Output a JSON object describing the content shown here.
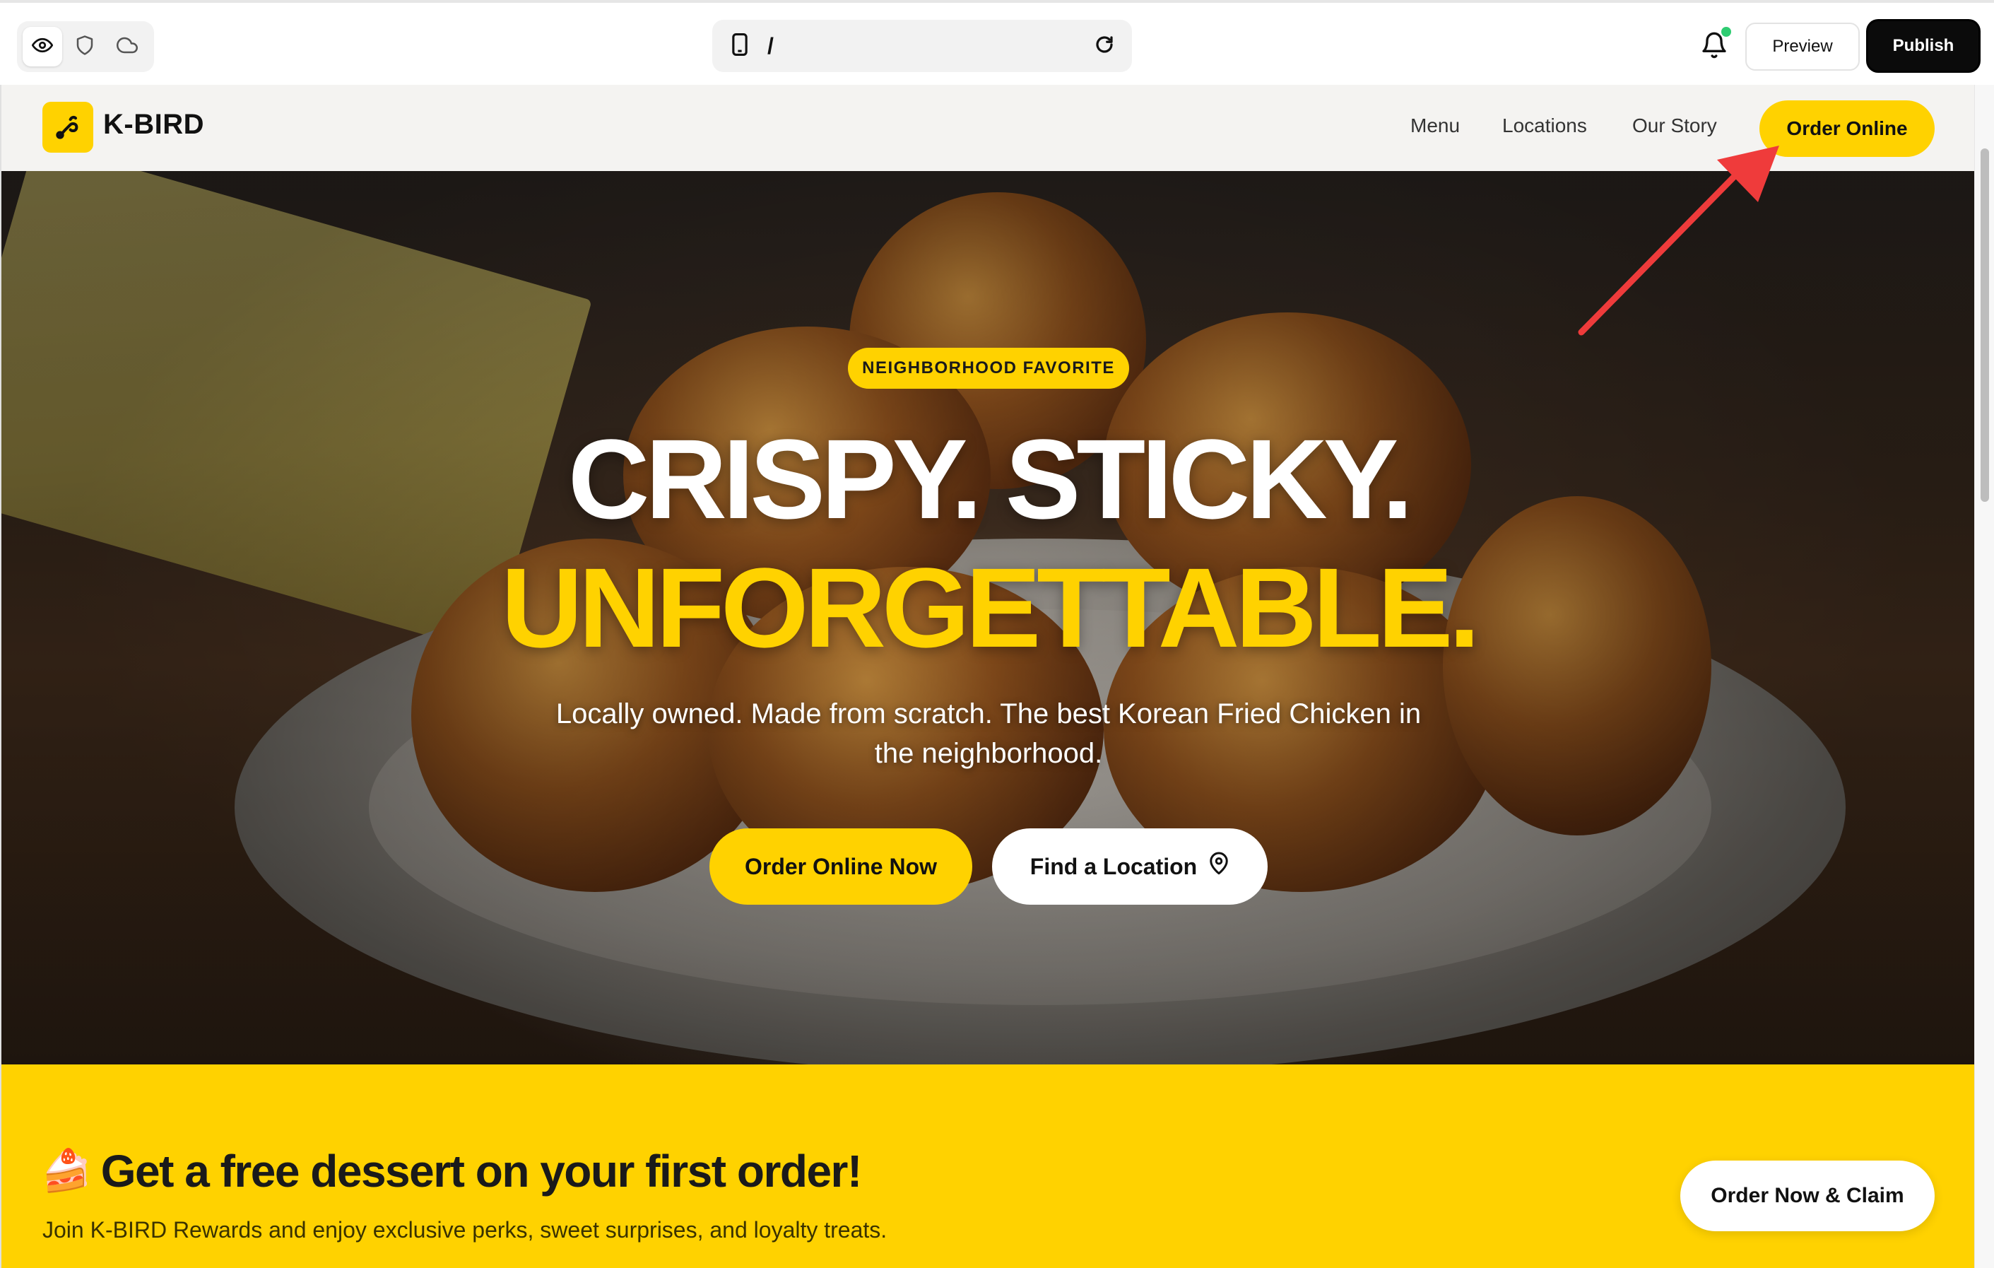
{
  "builder": {
    "tools": [
      {
        "icon": "eye-icon",
        "active": true
      },
      {
        "icon": "shield-icon",
        "active": false
      },
      {
        "icon": "cloud-icon",
        "active": false
      }
    ],
    "url_path": "/",
    "preview_label": "Preview",
    "publish_label": "Publish",
    "notification_dot_color": "#2ecc71"
  },
  "site": {
    "brand": {
      "name": "K-BIRD",
      "accent_color": "#ffd200"
    },
    "nav": {
      "links": [
        "Menu",
        "Locations",
        "Our Story"
      ],
      "cta": "Order Online"
    },
    "hero": {
      "badge": "NEIGHBORHOOD FAVORITE",
      "headline_line1": "CRISPY. STICKY.",
      "headline_line2": "UNFORGETTABLE.",
      "subtext": "Locally owned. Made from scratch. The best Korean Fried Chicken in the neighborhood.",
      "primary_cta": "Order Online Now",
      "secondary_cta": "Find a Location"
    },
    "promo": {
      "emoji": "🍰",
      "title": "Get a free dessert on your first order!",
      "subtitle": "Join K-BIRD Rewards and enjoy exclusive perks, sweet surprises, and loyalty treats.",
      "cta": "Order Now & Claim"
    }
  },
  "annotation": {
    "arrow_color": "#ef3b3b",
    "target": "Order Online"
  }
}
